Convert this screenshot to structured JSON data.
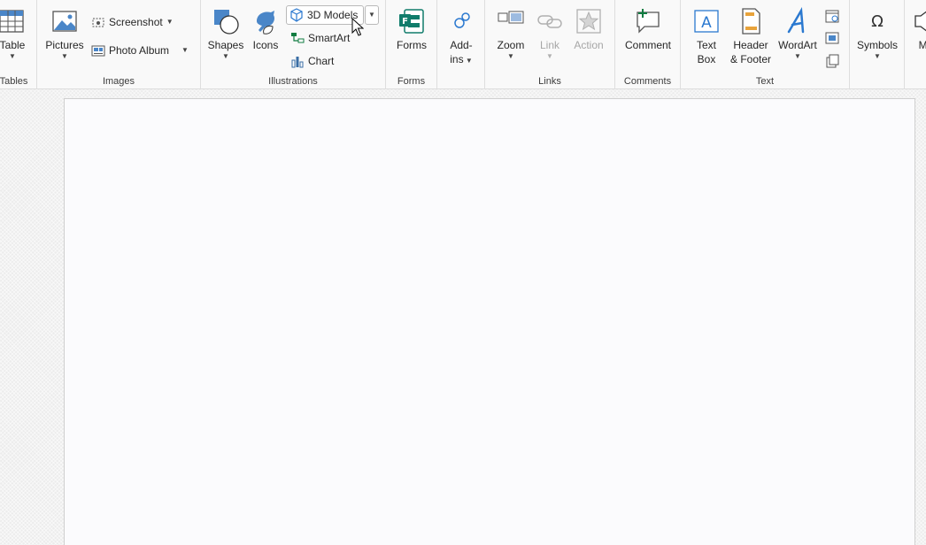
{
  "ribbon": {
    "groups": {
      "tables": {
        "label": "Tables",
        "table_label": "Table"
      },
      "images": {
        "label": "Images",
        "pictures_label": "Pictures",
        "screenshot_label": "Screenshot",
        "photo_album_label": "Photo Album"
      },
      "illustrations": {
        "label": "Illustrations",
        "shapes_label": "Shapes",
        "icons_label": "Icons",
        "models3d_label": "3D Models",
        "smartart_label": "SmartArt",
        "chart_label": "Chart"
      },
      "forms": {
        "label": "Forms",
        "forms_label": "Forms"
      },
      "addins": {
        "addins_line1": "Add-",
        "addins_line2": "ins"
      },
      "links": {
        "label": "Links",
        "zoom_label": "Zoom",
        "link_label": "Link",
        "action_label": "Action"
      },
      "comments": {
        "label": "Comments",
        "comment_label": "Comment"
      },
      "text": {
        "label": "Text",
        "textbox_line1": "Text",
        "textbox_line2": "Box",
        "header_line1": "Header",
        "header_line2": "& Footer",
        "wordart_label": "WordArt"
      },
      "symbols": {
        "symbols_label": "Symbols",
        "media_label_partial": "Me"
      }
    }
  },
  "colors": {
    "accent_blue": "#2b79d0",
    "forms_green": "#107c6b",
    "chart_blue": "#3a6ea5",
    "disabled_gray": "#a6a6a6"
  },
  "icons": [
    "table-icon",
    "pictures-icon",
    "screenshot-icon",
    "photo-album-icon",
    "shapes-icon",
    "icons-icon",
    "3d-models-icon",
    "smartart-icon",
    "chart-icon",
    "forms-icon",
    "addins-icon",
    "zoom-icon",
    "link-icon",
    "action-icon",
    "comment-icon",
    "textbox-icon",
    "header-footer-icon",
    "wordart-icon",
    "date-time-icon",
    "slide-number-icon",
    "object-icon",
    "omega-icon",
    "mouse-cursor-icon"
  ]
}
